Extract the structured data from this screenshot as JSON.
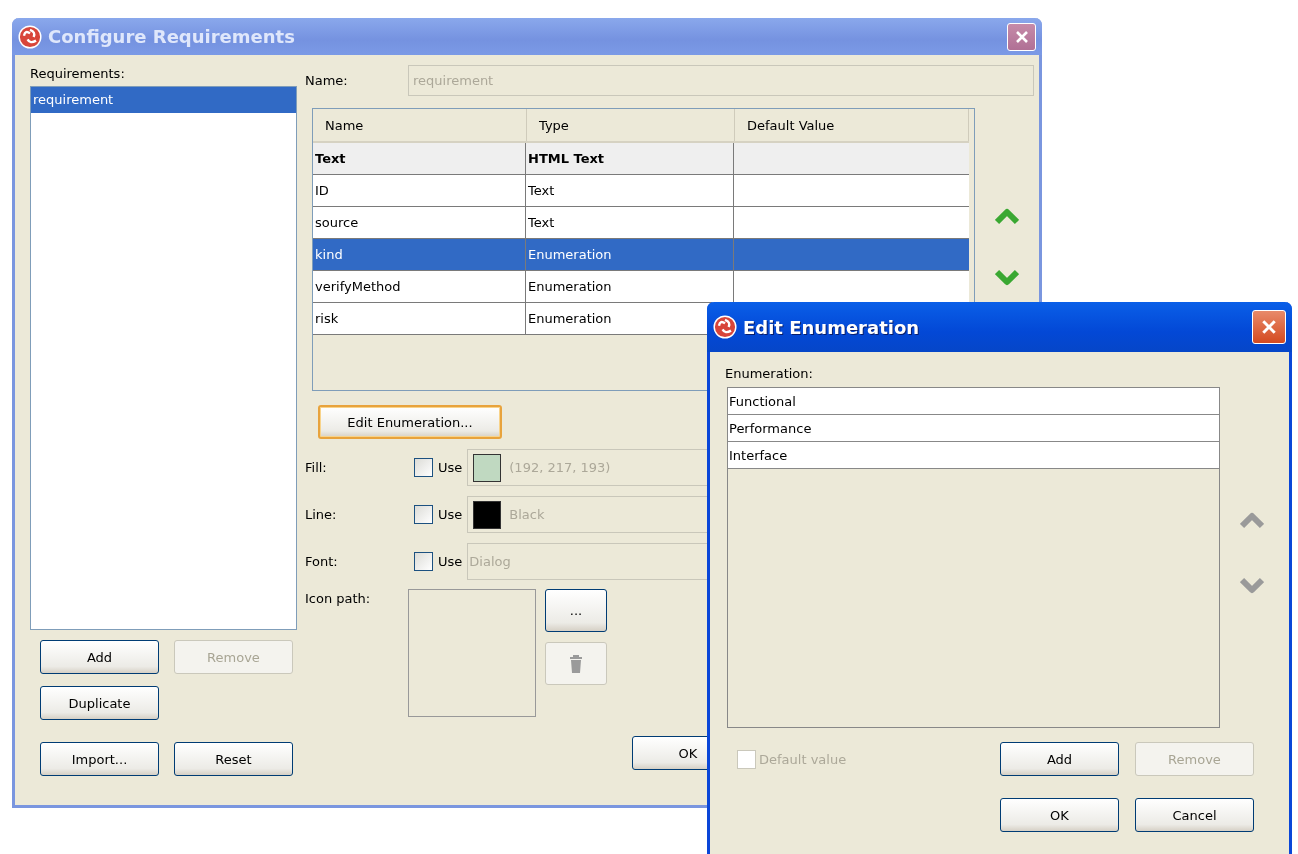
{
  "config_window": {
    "title": "Configure Requirements",
    "active": false,
    "requirements_label": "Requirements:",
    "requirements": [
      {
        "label": "requirement",
        "selected": true
      }
    ],
    "name_field": {
      "label": "Name:",
      "value": "requirement",
      "disabled": true
    },
    "table": {
      "columns": [
        "Name",
        "Type",
        "Default Value"
      ],
      "rows": [
        {
          "name": "Text",
          "type": "HTML Text",
          "kind": "builtin",
          "selected": false
        },
        {
          "name": "ID",
          "type": "Text",
          "kind": "custom",
          "selected": false
        },
        {
          "name": "source",
          "type": "Text",
          "kind": "custom",
          "selected": false
        },
        {
          "name": "kind",
          "type": "Enumeration",
          "kind": "custom",
          "selected": true
        },
        {
          "name": "verifyMethod",
          "type": "Enumeration",
          "kind": "custom",
          "selected": false
        },
        {
          "name": "risk",
          "type": "Enumeration",
          "kind": "custom",
          "selected": false
        }
      ]
    },
    "arrows_disabled": false,
    "edit_enumeration_button": {
      "label": "Edit Enumeration...",
      "focused": true
    },
    "style_rows": [
      {
        "label": "Fill:",
        "use_label": "Use",
        "checked": false,
        "kind": "color",
        "color": "#c0d9c1",
        "value": "(192, 217, 193)"
      },
      {
        "label": "Line:",
        "use_label": "Use",
        "checked": false,
        "kind": "color",
        "color": "#000000",
        "value": "Black"
      },
      {
        "label": "Font:",
        "use_label": "Use",
        "checked": false,
        "kind": "font",
        "value": "Dialog"
      }
    ],
    "icon_path": {
      "label": "Icon path:",
      "browse_button": "...",
      "delete_disabled": true
    },
    "button_rows": [
      [
        {
          "label": "Add",
          "disabled": false
        },
        {
          "label": "Remove",
          "disabled": true
        }
      ],
      [
        {
          "label": "Duplicate",
          "disabled": false
        }
      ],
      [
        {
          "label": "Import...",
          "disabled": false
        },
        {
          "label": "Reset",
          "disabled": false
        }
      ]
    ],
    "ok_button": "OK"
  },
  "enumeration_window": {
    "title": "Edit Enumeration",
    "active": true,
    "label": "Enumeration:",
    "items": [
      "Functional",
      "Performance",
      "Interface"
    ],
    "arrows_disabled": true,
    "default_value": {
      "label": "Default value",
      "checked": false,
      "disabled": true
    },
    "buttons": [
      {
        "label": "Add",
        "disabled": false
      },
      {
        "label": "Remove",
        "disabled": true
      },
      {
        "label": "OK",
        "disabled": false
      },
      {
        "label": "Cancel",
        "disabled": false
      }
    ]
  }
}
